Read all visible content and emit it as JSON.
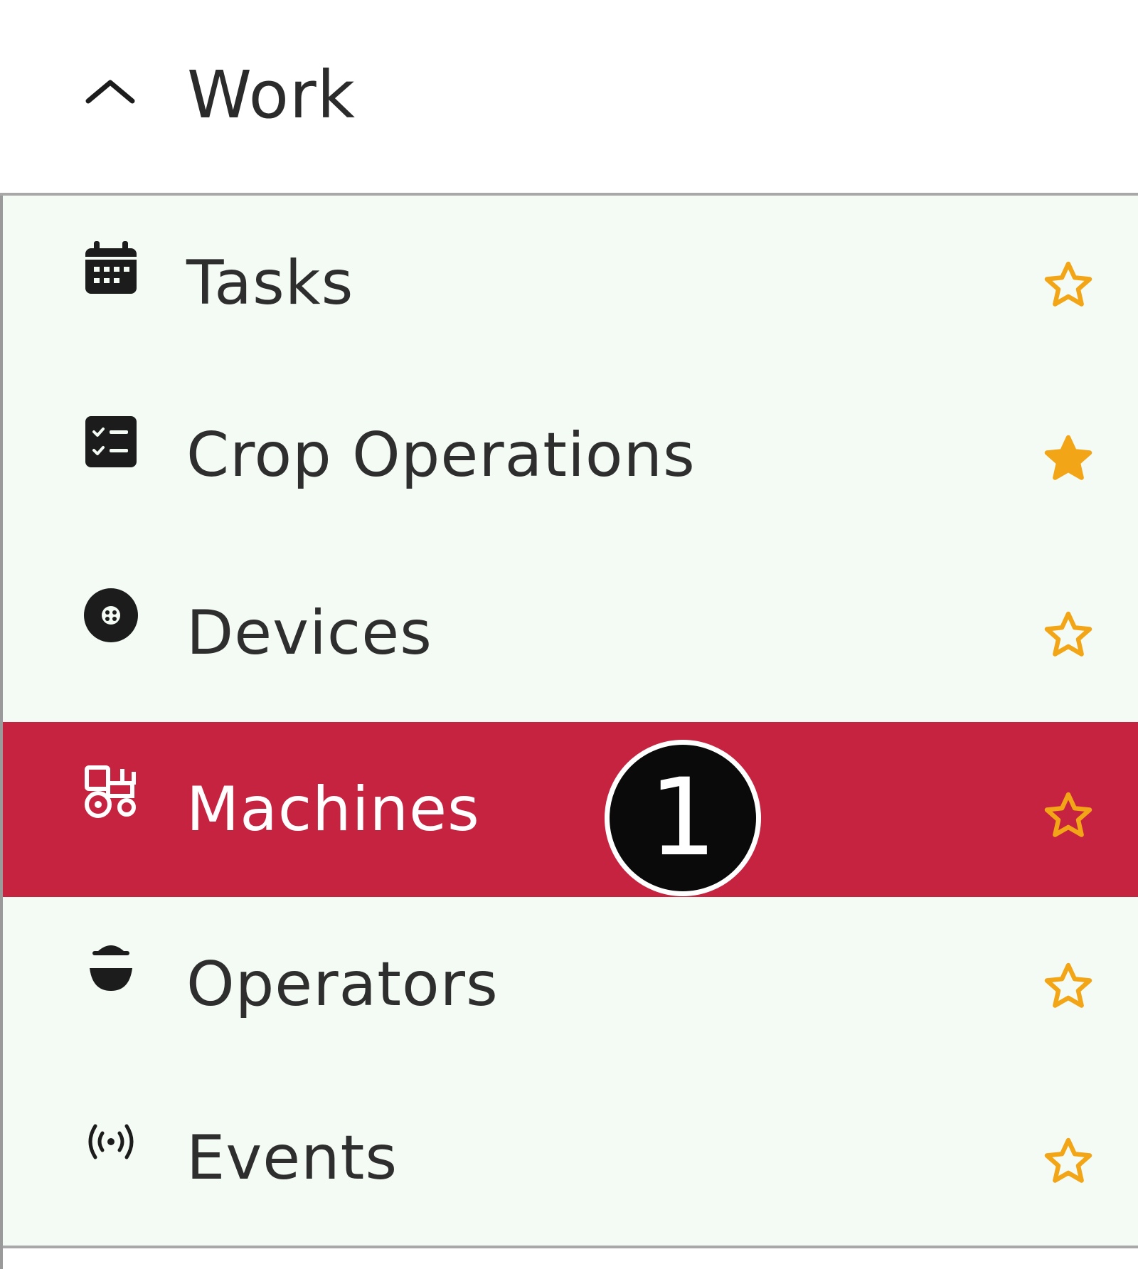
{
  "section": {
    "title": "Work",
    "collapse_icon": "chevron-up-icon"
  },
  "menu": {
    "items": [
      {
        "label": "Tasks",
        "icon": "calendar-icon",
        "favorite": false
      },
      {
        "label": "Crop Operations",
        "icon": "checklist-icon",
        "favorite": true
      },
      {
        "label": "Devices",
        "icon": "device-disc-icon",
        "favorite": false
      },
      {
        "label": "Machines",
        "icon": "tractor-icon",
        "favorite": false,
        "active": true
      },
      {
        "label": "Operators",
        "icon": "operator-icon",
        "favorite": false
      },
      {
        "label": "Events",
        "icon": "broadcast-icon",
        "favorite": false
      }
    ]
  },
  "callout": {
    "number": "1"
  },
  "colors": {
    "menu_background": "#f3fbf4",
    "active_background": "#c62340",
    "star": "#f2a516",
    "icon": "#1c1c1c",
    "text": "#2e2e2e",
    "divider": "#a8a8a8"
  }
}
